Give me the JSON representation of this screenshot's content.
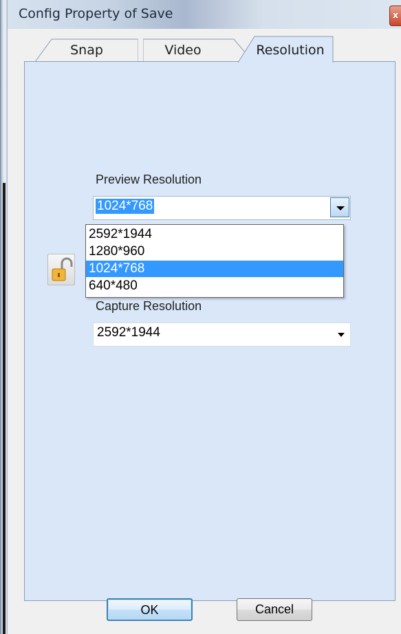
{
  "window": {
    "title": "Config Property of Save",
    "close_glyph": "x"
  },
  "tabs": [
    {
      "label": "Snap",
      "active": false
    },
    {
      "label": "Video",
      "active": false
    },
    {
      "label": "Resolution",
      "active": true
    }
  ],
  "preview": {
    "label": "Preview Resolution",
    "selected_value": "1024*768",
    "dropdown_open": true,
    "options": [
      "2592*1944",
      "1280*960",
      "1024*768",
      "640*480"
    ],
    "highlighted_index": 2
  },
  "capture": {
    "label": "Capture Resolution",
    "selected_value": "2592*1944"
  },
  "lock_icon": "unlocked-padlock-icon",
  "buttons": {
    "ok_label": "OK",
    "cancel_label": "Cancel"
  },
  "colors": {
    "panel_bg": "#dae7f8",
    "selection": "#3399ff"
  }
}
